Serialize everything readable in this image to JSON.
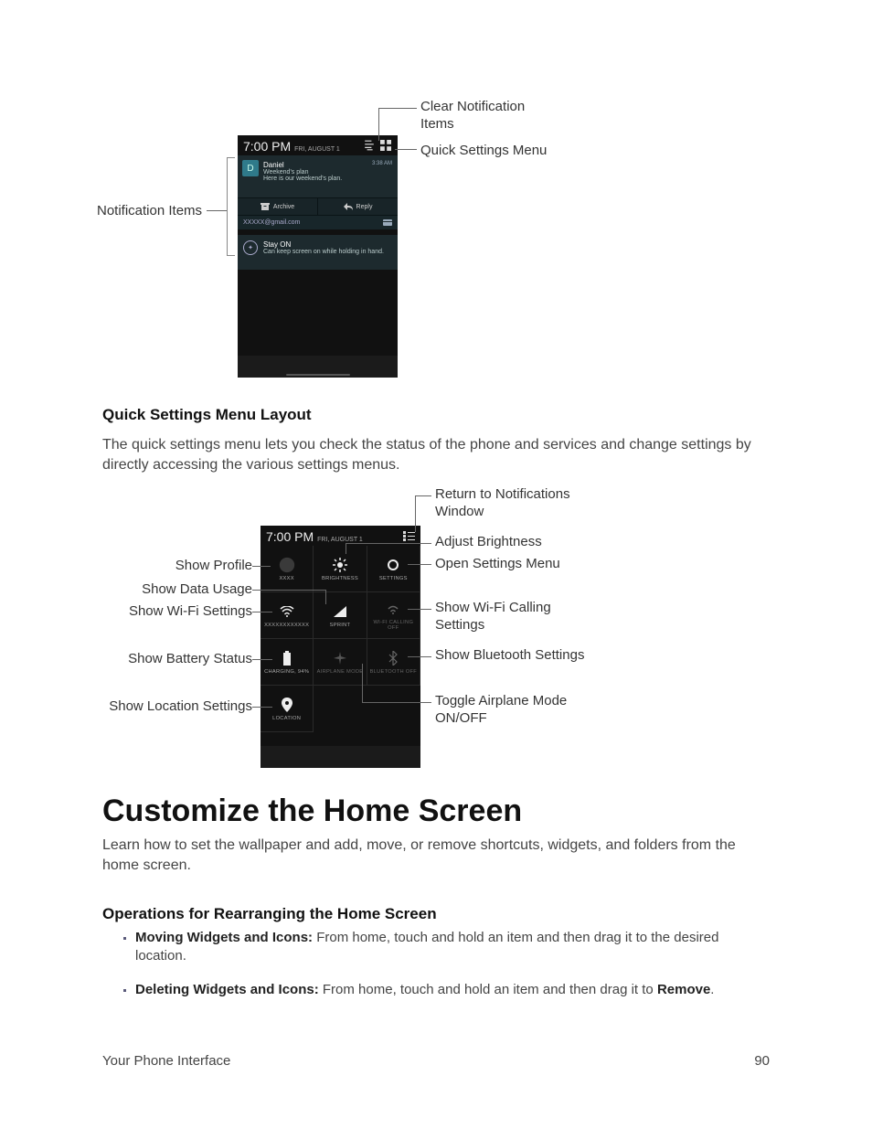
{
  "fig1": {
    "labels": {
      "notification_items": "Notification Items",
      "clear_notifications": "Clear Notification Items",
      "quick_settings_menu": "Quick Settings Menu"
    },
    "statusbar": {
      "time": "7:00 PM",
      "date": "FRI, AUGUST 1"
    },
    "notif1": {
      "avatar_letter": "D",
      "title": "Daniel",
      "line1": "Weekend's plan",
      "line2": "Here is our weekend's plan.",
      "time": "3:38 AM",
      "action_archive": "Archive",
      "action_reply": "Reply",
      "account": "XXXXX@gmail.com"
    },
    "notif2": {
      "title": "Stay ON",
      "line": "Can keep screen on while holding in hand."
    }
  },
  "qs_section": {
    "heading": "Quick Settings Menu Layout",
    "body": "The quick settings menu lets you check the status of the phone and services and change settings by directly accessing the various settings menus."
  },
  "fig2": {
    "statusbar": {
      "time": "7:00 PM",
      "date": "FRI, AUGUST 1"
    },
    "left_labels": {
      "profile": "Show Profile",
      "data": "Show Data Usage",
      "wifi": "Show Wi-Fi Settings",
      "battery": "Show Battery Status",
      "location": "Show Location Settings"
    },
    "right_labels": {
      "return": "Return to Notifications Window",
      "brightness": "Adjust Brightness",
      "settings": "Open Settings Menu",
      "wifi_calling": "Show Wi-Fi Calling Settings",
      "bluetooth": "Show Bluetooth Settings",
      "airplane": "Toggle Airplane Mode ON/OFF"
    },
    "tiles": {
      "profile": "XXXX",
      "brightness": "BRIGHTNESS",
      "settings": "SETTINGS",
      "wifi": "XXXXXXXXXXXX",
      "sprint": "SPRINT",
      "wifi_calling": "WI-FI CALLING OFF",
      "battery": "CHARGING, 94%",
      "airplane": "AIRPLANE MODE",
      "bluetooth": "BLUETOOTH OFF",
      "location": "LOCATION"
    }
  },
  "customize": {
    "heading": "Customize the Home Screen",
    "body": "Learn how to set the wallpaper and add, move, or remove shortcuts, widgets, and folders from the home screen.",
    "ops_heading": "Operations for Rearranging the Home Screen",
    "op1_bold": "Moving Widgets and Icons:",
    "op1_rest": " From home, touch and hold an item and then drag it to the desired location.",
    "op2_bold": "Deleting Widgets and Icons:",
    "op2_rest_a": " From home, touch and hold an item and then drag it to ",
    "op2_rest_b": "Remove",
    "op2_rest_c": "."
  },
  "footer": {
    "left": "Your Phone Interface",
    "right": "90"
  }
}
